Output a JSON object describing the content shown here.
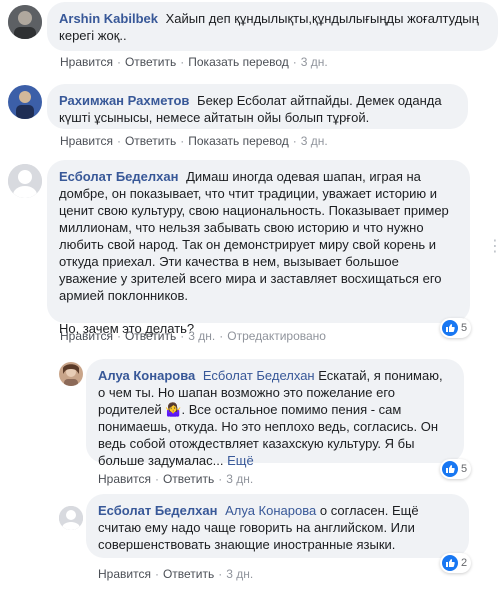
{
  "comments": [
    {
      "author": "Arshin Kabilbek",
      "text": "Хайып деп құндылықты,құндылығыңды жоғалтудың керегі жоқ..",
      "actions": {
        "like": "Нравится",
        "reply": "Ответить",
        "translate": "Показать перевод",
        "time": "3 дн."
      }
    },
    {
      "author": "Рахимжан Рахметов",
      "text": "Бекер Есболат айтпайды. Демек оданда күшті ұсынысы, немесе айтатын ойы болып тұрғой.",
      "actions": {
        "like": "Нравится",
        "reply": "Ответить",
        "translate": "Показать перевод",
        "time": "3 дн."
      }
    },
    {
      "author": "Есболат Беделхан",
      "text": "Димаш иногда одевая шапан, играя на домбре, он показывает, что чтит традиции, уважает историю и ценит свою культуру, свою национальность. Показывает пример миллионам, что нельзя забывать свою историю и что нужно любить свой народ. Так он демонстрирует миру свой корень и откуда приехал. Эти качества в нем, вызывает большое уважение у зрителей всего мира и заставляет восхищаться его армией поклонников.",
      "text2": "Но, зачем это делать?",
      "actions": {
        "like": "Нравится",
        "reply": "Ответить",
        "time": "3 дн.",
        "edited": "Отредактировано"
      },
      "reactions": "5"
    },
    {
      "author": "Алуа Конарова",
      "mention": "Есболат Беделхан",
      "text": "Ескатай, я понимаю, о чем ты. Но шапан возможно это пожелание его родителей 🤷‍♀️. Все остальное помимо пения - сам понимаешь, откуда. Но это неплохо ведь, согласись. Он ведь собой отождествляет казахскую культуру. Я бы больше задумалас...",
      "see_more": "Ещё",
      "actions": {
        "like": "Нравится",
        "reply": "Ответить",
        "time": "3 дн."
      },
      "reactions": "5"
    },
    {
      "author": "Есболат Беделхан",
      "mention": "Алуа Конарова",
      "text": "о согласен. Ещё считаю ему надо чаще говорить на английском. Или совершенствовать знающие иностранные языки.",
      "actions": {
        "like": "Нравится",
        "reply": "Ответить",
        "time": "3 дн."
      },
      "reactions": "2"
    }
  ],
  "icons": {
    "like": "thumbs-up-icon",
    "more": "more-dots-icon"
  },
  "colors": {
    "link": "#385898",
    "bubble": "#f0f2f5",
    "like": "#1877f2"
  }
}
